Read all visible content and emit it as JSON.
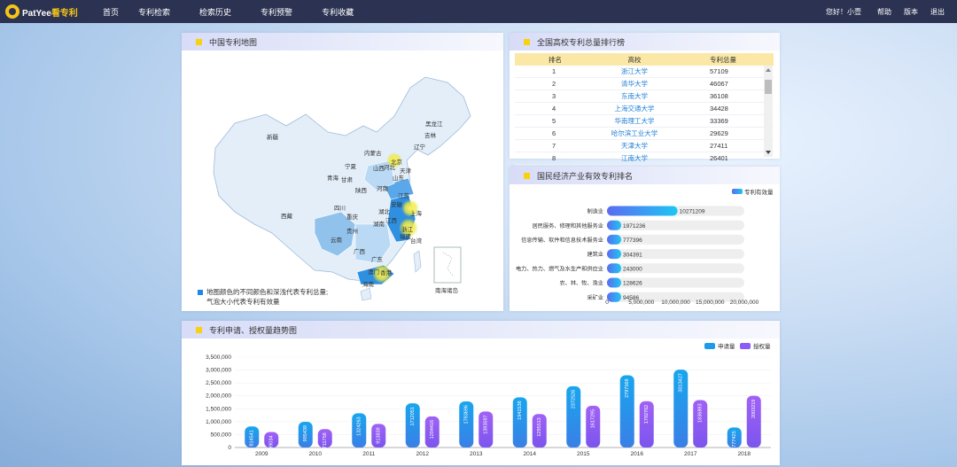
{
  "header": {
    "logo_brand": "PatYee",
    "logo_suffix": "看专利",
    "nav": [
      "首页",
      "专利检索",
      "检索历史",
      "专利预警",
      "专利收藏"
    ],
    "greeting": "您好！小壹",
    "links": [
      "帮助",
      "版本",
      "退出"
    ]
  },
  "map_panel": {
    "title": "中国专利地图",
    "note_line1": "地图颜色的不同颜色和深浅代表专利总量;",
    "note_line2": "气泡大小代表专利有效量",
    "inset_label": "南海诸岛",
    "provinces": [
      "黑龙江",
      "吉林",
      "辽宁",
      "内蒙古",
      "北京",
      "天津",
      "河北",
      "山西",
      "宁夏",
      "山东",
      "新疆",
      "青海",
      "甘肃",
      "陕西",
      "河南",
      "江苏",
      "安徽",
      "上海",
      "湖北",
      "西藏",
      "四川",
      "重庆",
      "浙江",
      "江西",
      "湖南",
      "贵州",
      "云南",
      "福建",
      "台湾",
      "广西",
      "广东",
      "香港",
      "澳门",
      "海南"
    ]
  },
  "ranking_panel": {
    "title": "全国高校专利总量排行榜",
    "columns": [
      "排名",
      "高校",
      "专利总量"
    ],
    "rows": [
      {
        "rank": "1",
        "school": "浙江大学",
        "total": "57109"
      },
      {
        "rank": "2",
        "school": "清华大学",
        "total": "46067"
      },
      {
        "rank": "3",
        "school": "东南大学",
        "total": "36108"
      },
      {
        "rank": "4",
        "school": "上海交通大学",
        "total": "34428"
      },
      {
        "rank": "5",
        "school": "华南理工大学",
        "total": "33369"
      },
      {
        "rank": "6",
        "school": "哈尔滨工业大学",
        "total": "29629"
      },
      {
        "rank": "7",
        "school": "天津大学",
        "total": "27411"
      },
      {
        "rank": "8",
        "school": "江南大学",
        "total": "26401"
      }
    ]
  },
  "chart_data": [
    {
      "type": "bar",
      "title": "国民经济产业有效专利排名",
      "orientation": "horizontal",
      "legend": "专利有效量",
      "categories": [
        "制造业",
        "居民服务、修理和其他服务业",
        "信息传输、软件和信息技术服务业",
        "建筑业",
        "电力、热力、燃气及水生产和供应业",
        "农、林、牧、渔业",
        "采矿业"
      ],
      "values": [
        10271209,
        1971236,
        777396,
        304391,
        243000,
        128626,
        94586
      ],
      "value_labels": [
        "10271209",
        "1971236",
        "777396",
        "304391",
        "243000",
        "128626",
        "94586"
      ],
      "xlim": [
        0,
        20000000
      ],
      "xticks": [
        "0",
        "5,000,000",
        "10,000,000",
        "15,000,000",
        "20,000,000"
      ],
      "colors": {
        "bar_start": "#5b6cf0",
        "bar_end": "#1ec6f4",
        "track": "#eeeeee"
      }
    },
    {
      "type": "bar",
      "title": "专利申请、授权量趋势图",
      "categories": [
        "2009",
        "2010",
        "2011",
        "2012",
        "2013",
        "2014",
        "2015",
        "2016",
        "2017",
        "2018"
      ],
      "series": [
        {
          "name": "申请量",
          "values": [
            814541,
            995439,
            1324263,
            1712051,
            1783696,
            1941538,
            2372526,
            2797568,
            3013427,
            777425
          ],
          "labels": [
            "814541",
            "995439",
            "1324263",
            "1712051",
            "1783696",
            "1941538",
            "2372526",
            "2797568",
            "3013427",
            "777425"
          ],
          "color": "#1e9be8"
        },
        {
          "name": "授权量",
          "values": [
            599034,
            711758,
            913839,
            1204416,
            1393597,
            1295513,
            1617295,
            1792762,
            1836893,
            2003219
          ],
          "labels": [
            "599034",
            "711758",
            "913839",
            "1204416",
            "1393597",
            "1295513",
            "1617295",
            "1792762",
            "1836893",
            "2003219"
          ],
          "color": "#8b5cf6"
        }
      ],
      "ylim": [
        0,
        3500000
      ],
      "yticks": [
        "0",
        "500,000",
        "1,000,000",
        "1,500,000",
        "2,000,000",
        "2,500,000",
        "3,000,000",
        "3,500,000"
      ]
    }
  ]
}
